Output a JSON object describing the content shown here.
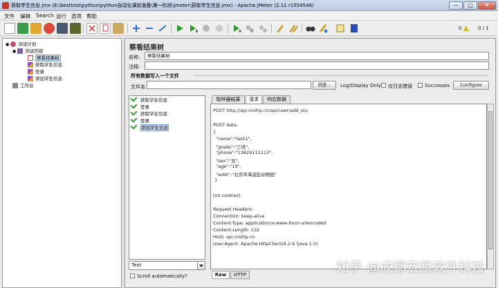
{
  "window": {
    "title": "获取学生信息.jmx (E:\\besttest\\python\\python自动化课前准备\\第一阶段\\jmeter\\获取学生信息.jmx) - Apache JMeter (2.11 r1554548)",
    "minimize": "—",
    "maximize": "□",
    "close": "✕"
  },
  "menu": [
    "文件",
    "编辑",
    "Search",
    "运行",
    "选项",
    "帮助"
  ],
  "toolbar": {
    "icons": [
      "new-icon",
      "templates-icon",
      "open-icon",
      "close-file-icon",
      "save-icon",
      "save-as-icon",
      "cut-icon",
      "copy-icon",
      "paste-icon",
      "expand-icon",
      "collapse-icon",
      "toggle-icon",
      "start-icon",
      "start-no-pause-icon",
      "stop-icon",
      "shutdown-icon",
      "remote-start-icon",
      "remote-stop-icon",
      "remote-shutdown-icon",
      "clear-icon",
      "clear-all-icon",
      "search-icon",
      "reset-search-icon",
      "function-helper-icon",
      "help-icon"
    ],
    "warnings": "0",
    "threads": "0 / 1"
  },
  "tree": {
    "items": [
      {
        "label": "测试计划",
        "level": 0,
        "icon": "test-plan-icon"
      },
      {
        "label": "测试内容",
        "level": 1,
        "icon": "thread-group-icon"
      },
      {
        "label": "察看结果树",
        "level": 2,
        "icon": "listener-icon",
        "selected": true
      },
      {
        "label": "获取学生信息",
        "level": 2,
        "icon": "sampler-icon"
      },
      {
        "label": "登录",
        "level": 2,
        "icon": "sampler-icon"
      },
      {
        "label": "添加学生信息",
        "level": 2,
        "icon": "sampler-icon"
      },
      {
        "label": "工作台",
        "level": 0,
        "icon": "workbench-icon"
      }
    ]
  },
  "panel": {
    "heading": "察看结果树",
    "name_label": "名称:",
    "name_value": "察看结果树",
    "comment_label": "注释:",
    "comment_value": "",
    "file_group_title": "所有数据写入一个文件",
    "filename_label": "文件名",
    "filename_value": "",
    "browse_label": "浏览...",
    "logdisplay_label": "Log/Display Only:",
    "errors_label": "仅日志错误",
    "successes_label": "Successes",
    "configure_label": "Configure"
  },
  "samples": [
    {
      "label": "获取学生信息",
      "selected": false
    },
    {
      "label": "登录",
      "selected": false
    },
    {
      "label": "获取学生信息",
      "selected": false
    },
    {
      "label": "登录",
      "selected": false
    },
    {
      "label": "添加学生信息",
      "selected": true
    }
  ],
  "renderer": {
    "value": "Text",
    "scroll_label": "Scroll automatically?"
  },
  "tabs": [
    {
      "label": "取样器结果",
      "active": false
    },
    {
      "label": "请求",
      "active": true
    },
    {
      "label": "响应数据",
      "active": false
    }
  ],
  "request_lines": [
    "POST http://api.nnzhp.cn/api/user/add_stu",
    "",
    "POST data:",
    "{",
    "  \"name\":\"test1\",",
    "  \"grade\":\"三班\",",
    "  \"phone\":\"13829111113\",",
    "  \"sex\":\"女\",",
    "  \"age\":\"19\",",
    "  \"addr\":\"北京市海淀区动物园\"",
    " }",
    "",
    "[no cookies]",
    "",
    "Request Headers:",
    "Connection: keep-alive",
    "Content-Type: application/x-www-form-urlencoded",
    "Content-Length: 132",
    "Host: api.nnzhp.cn",
    "User-Agent: Apache-HttpClient/4.2.6 (java 1.5)"
  ],
  "bottom_tabs": [
    {
      "label": "Raw",
      "active": true
    },
    {
      "label": "HTTP",
      "active": false
    }
  ],
  "watermark": "知乎 @成都宏鹰软件科技",
  "colors": {
    "selection": "#c5d8f0",
    "success_check": "#2e9a2e",
    "panel_bg": "#ececec"
  }
}
